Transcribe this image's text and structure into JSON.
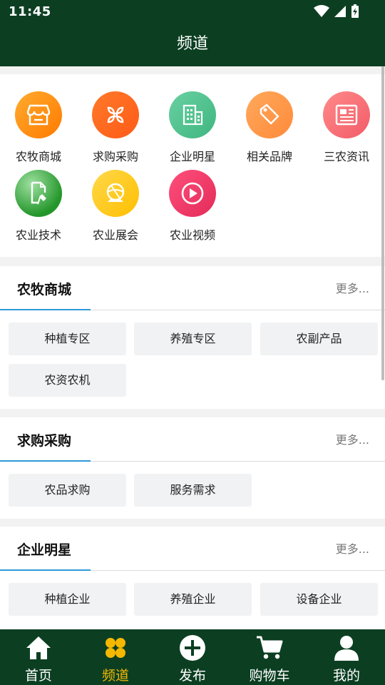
{
  "status_bar": {
    "time": "11:45"
  },
  "header": {
    "title": "频道"
  },
  "channels": [
    {
      "label": "农牧商城",
      "icon": "store-icon",
      "color_from": "#ffab2e",
      "color_to": "#ff7a00"
    },
    {
      "label": "求购采购",
      "icon": "purchase-icon",
      "color_from": "#ff7a2a",
      "color_to": "#ff5a16"
    },
    {
      "label": "企业明星",
      "icon": "building-icon",
      "color_from": "#69d0a2",
      "color_to": "#3fb67f"
    },
    {
      "label": "相关品牌",
      "icon": "tag-icon",
      "color_from": "#ffa95c",
      "color_to": "#ff8a3a"
    },
    {
      "label": "三农资讯",
      "icon": "news-icon",
      "color_from": "#ff8a8a",
      "color_to": "#f25c68"
    },
    {
      "label": "农业技术",
      "icon": "tech-icon",
      "color_from": "#63c66a",
      "color_to": "#23962a"
    },
    {
      "label": "农业展会",
      "icon": "expo-icon",
      "color_from": "#ffd84a",
      "color_to": "#ffbf00"
    },
    {
      "label": "农业视频",
      "icon": "video-icon",
      "color_from": "#ff4f7c",
      "color_to": "#e32b59"
    }
  ],
  "sections": [
    {
      "title": "农牧商城",
      "more": "更多...",
      "tags": [
        "种植专区",
        "养殖专区",
        "农副产品",
        "农资农机"
      ]
    },
    {
      "title": "求购采购",
      "more": "更多...",
      "tags": [
        "农品求购",
        "服务需求"
      ]
    },
    {
      "title": "企业明星",
      "more": "更多...",
      "tags": [
        "种植企业",
        "养殖企业",
        "设备企业"
      ]
    }
  ],
  "bottom_nav": [
    {
      "label": "首页",
      "icon": "home-icon",
      "active": false
    },
    {
      "label": "频道",
      "icon": "channels-icon",
      "active": true
    },
    {
      "label": "发布",
      "icon": "publish-plus-icon",
      "active": false
    },
    {
      "label": "购物车",
      "icon": "cart-icon",
      "active": false
    },
    {
      "label": "我的",
      "icon": "profile-icon",
      "active": false
    }
  ],
  "colors": {
    "bar": "#0c3f22",
    "active": "#f5b800",
    "underline": "#2f9ad8"
  }
}
